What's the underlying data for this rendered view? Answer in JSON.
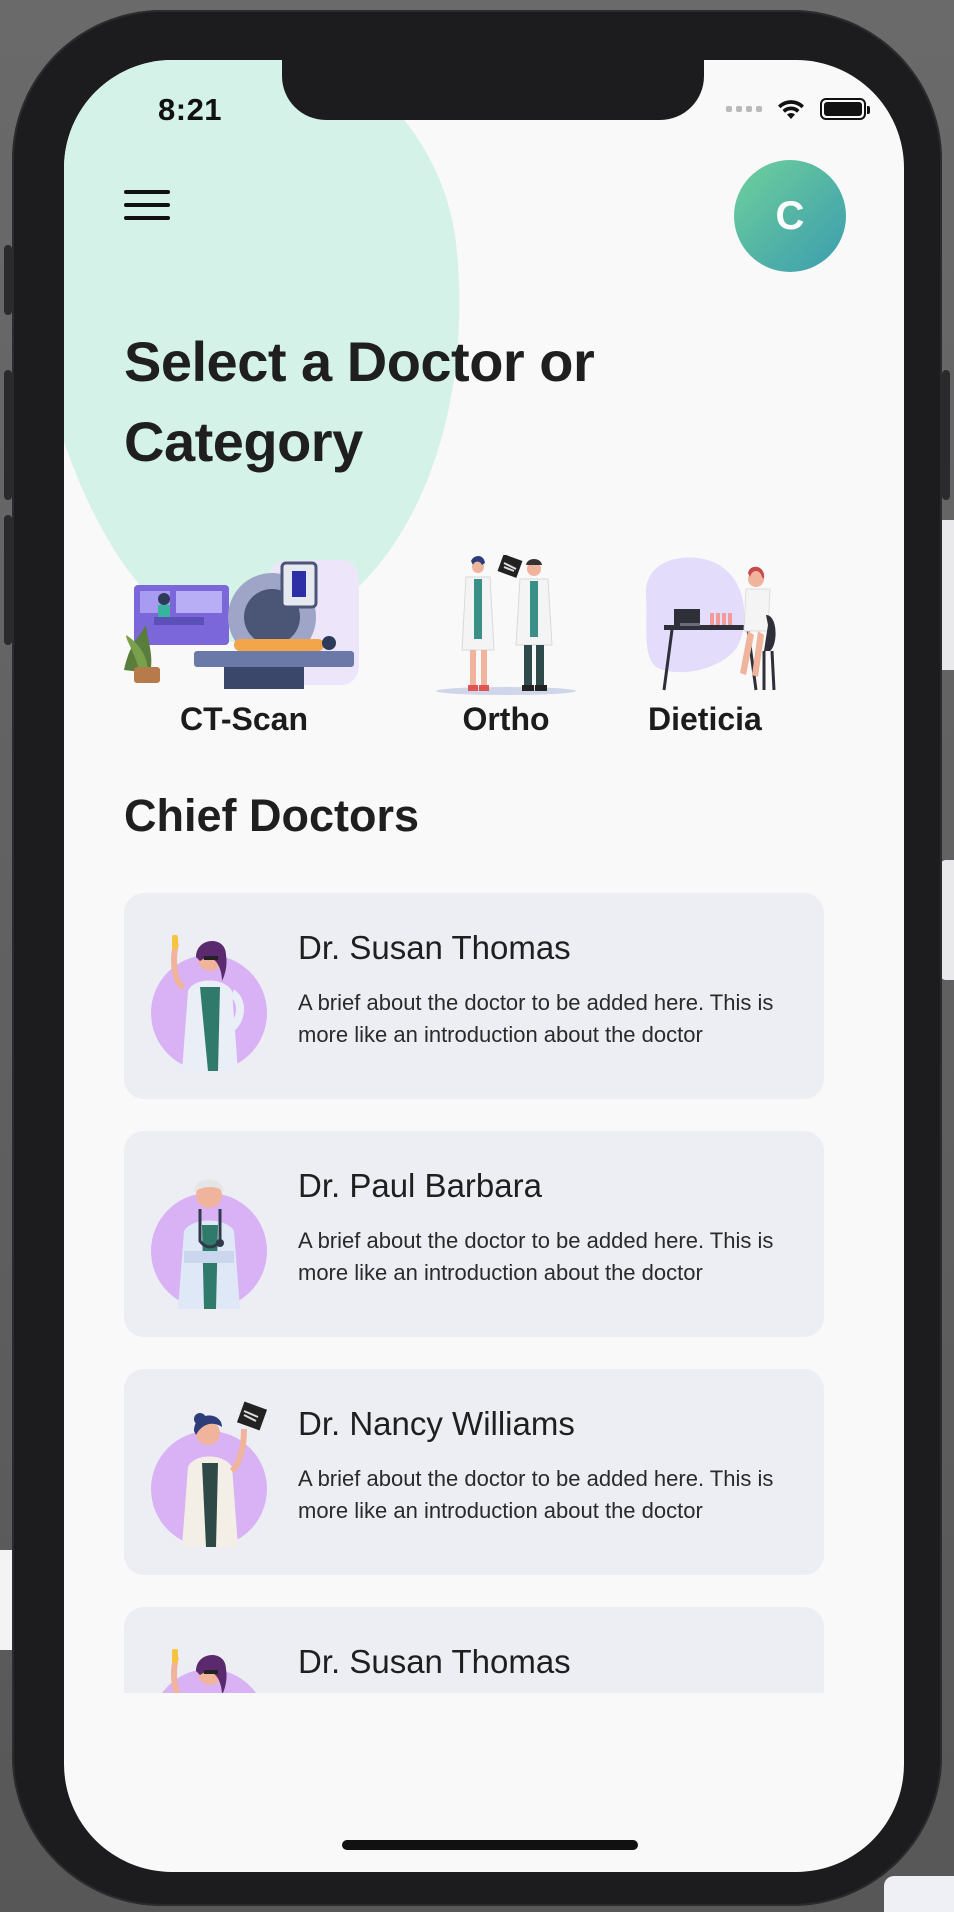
{
  "status_bar": {
    "time": "8:21"
  },
  "header": {
    "avatar_initial": "C"
  },
  "page_title": "Select a Doctor or Category",
  "categories": [
    {
      "label": "CT-Scan",
      "icon": "ct-scan-illustration"
    },
    {
      "label": "Ortho",
      "icon": "ortho-doctors-illustration"
    },
    {
      "label": "Dieticia",
      "icon": "dietician-illustration"
    }
  ],
  "section_title": "Chief Doctors",
  "doctors": [
    {
      "name": "Dr. Susan Thomas",
      "brief": "A brief about the doctor to be added here. This is more like an introduction about the doctor"
    },
    {
      "name": "Dr. Paul Barbara",
      "brief": "A brief about the doctor to be added here. This is more like an introduction about the doctor"
    },
    {
      "name": "Dr. Nancy Williams",
      "brief": "A brief about the doctor to be added here. This is more like an introduction about the doctor"
    },
    {
      "name": "Dr. Susan Thomas",
      "brief": ""
    }
  ],
  "colors": {
    "accent_blob": "#d4f2e8",
    "avatar_gradient_start": "#6fd19b",
    "avatar_gradient_end": "#3c9fb0",
    "card_background": "#eceef3",
    "portrait_circle": "#d9b2f5"
  }
}
